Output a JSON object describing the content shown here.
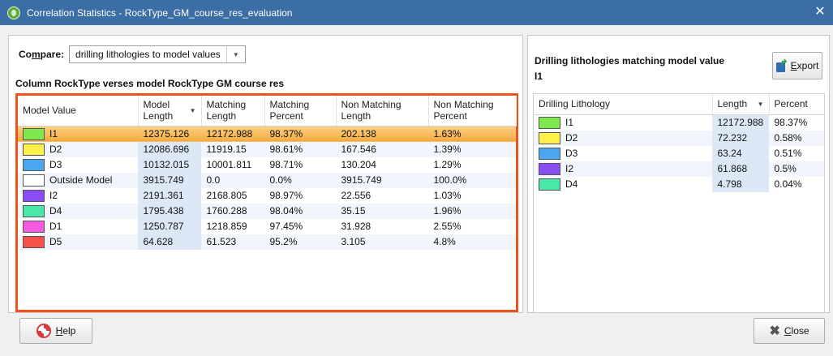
{
  "window": {
    "title": "Correlation Statistics - RockType_GM_course_res_evaluation",
    "close_glyph": "✕"
  },
  "compare": {
    "label_mnemonic": "m",
    "label_pre": "Co",
    "label_post": "pare:",
    "selected": "drilling lithologies to model values",
    "arrow": "▼"
  },
  "main": {
    "heading": "Column RockType verses model RockType GM course res",
    "columns": [
      {
        "label": "Model Value",
        "sorted": false
      },
      {
        "label": "Model Length",
        "sorted": true
      },
      {
        "label": "Matching Length",
        "sorted": false
      },
      {
        "label": "Matching Percent",
        "sorted": false
      },
      {
        "label": "Non Matching Length",
        "sorted": false
      },
      {
        "label": "Non Matching Percent",
        "sorted": false
      }
    ],
    "sort_arrow": "▼",
    "rows": [
      {
        "name": "I1",
        "color": "#7fe84f",
        "model_length": "12375.126",
        "matching_length": "12172.988",
        "matching_percent": "98.37%",
        "non_matching_length": "202.138",
        "non_matching_percent": "1.63%",
        "selected": true
      },
      {
        "name": "D2",
        "color": "#fff04a",
        "model_length": "12086.696",
        "matching_length": "11919.15",
        "matching_percent": "98.61%",
        "non_matching_length": "167.546",
        "non_matching_percent": "1.39%",
        "selected": false
      },
      {
        "name": "D3",
        "color": "#4aa8f0",
        "model_length": "10132.015",
        "matching_length": "10001.811",
        "matching_percent": "98.71%",
        "non_matching_length": "130.204",
        "non_matching_percent": "1.29%",
        "selected": false
      },
      {
        "name": "Outside Model",
        "color": "#ffffff",
        "model_length": "3915.749",
        "matching_length": "0.0",
        "matching_percent": "0.0%",
        "non_matching_length": "3915.749",
        "non_matching_percent": "100.0%",
        "selected": false
      },
      {
        "name": "I2",
        "color": "#8a4cf5",
        "model_length": "2191.361",
        "matching_length": "2168.805",
        "matching_percent": "98.97%",
        "non_matching_length": "22.556",
        "non_matching_percent": "1.03%",
        "selected": false
      },
      {
        "name": "D4",
        "color": "#4ae8a8",
        "model_length": "1795.438",
        "matching_length": "1760.288",
        "matching_percent": "98.04%",
        "non_matching_length": "35.15",
        "non_matching_percent": "1.96%",
        "selected": false
      },
      {
        "name": "D1",
        "color": "#f55ae0",
        "model_length": "1250.787",
        "matching_length": "1218.859",
        "matching_percent": "97.45%",
        "non_matching_length": "31.928",
        "non_matching_percent": "2.55%",
        "selected": false
      },
      {
        "name": "D5",
        "color": "#f5524a",
        "model_length": "64.628",
        "matching_length": "61.523",
        "matching_percent": "95.2%",
        "non_matching_length": "3.105",
        "non_matching_percent": "4.8%",
        "selected": false
      }
    ]
  },
  "side": {
    "heading_line1": "Drilling lithologies matching model value",
    "heading_line2": "I1",
    "export_label_mnemonic": "E",
    "export_label_rest": "xport",
    "columns": [
      {
        "label": "Drilling Lithology"
      },
      {
        "label": "Length"
      },
      {
        "label": "Percent"
      }
    ],
    "sort_arrow": "▼",
    "rows": [
      {
        "name": "I1",
        "color": "#7fe84f",
        "length": "12172.988",
        "percent": "98.37%"
      },
      {
        "name": "D2",
        "color": "#fff04a",
        "length": "72.232",
        "percent": "0.58%"
      },
      {
        "name": "D3",
        "color": "#4aa8f0",
        "length": "63.24",
        "percent": "0.51%"
      },
      {
        "name": "I2",
        "color": "#8a4cf5",
        "length": "61.868",
        "percent": "0.5%"
      },
      {
        "name": "D4",
        "color": "#4ae8a8",
        "length": "4.798",
        "percent": "0.04%"
      }
    ]
  },
  "buttons": {
    "help_mnemonic": "H",
    "help_rest": "elp",
    "close_mnemonic": "C",
    "close_rest": "lose",
    "close_glyph": "✖"
  },
  "colors": {
    "titlebar": "#3a6ea5",
    "highlight_border": "#f0521a",
    "selected_row": "#f4a93c"
  },
  "icons": [
    "app-icon",
    "export-icon",
    "help-icon",
    "close-icon",
    "chevron-down-icon",
    "sort-arrow-icon"
  ]
}
